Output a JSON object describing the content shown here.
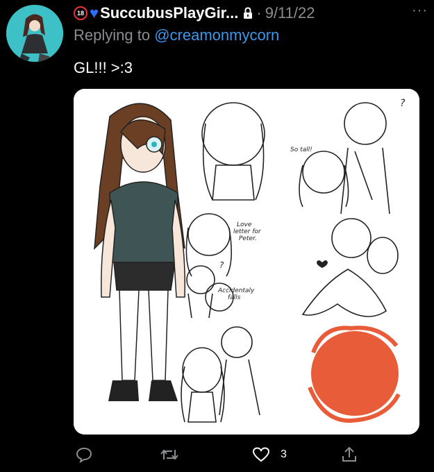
{
  "tweet": {
    "badge": "18",
    "display_name": "SuccubusPlayGir...",
    "date": "9/11/22",
    "separator": "·",
    "more": "···",
    "replying_prefix": "Replying to",
    "replying_handle": "@creamonmycorn",
    "text": "GL!!! >:3"
  },
  "artwork_notes": {
    "so_tall": "So tall!",
    "question1": "?",
    "love_letter": "Love letter for Peter.",
    "question2": "?",
    "accidentally_falls": "Accidentaly falls"
  },
  "actions": {
    "like_count": "3"
  },
  "colors": {
    "link": "#3b98ea",
    "muted": "#8a8d91",
    "heart_emoji": "#2f6df5",
    "scribble": "#e8542f",
    "avatar_bg": "#3ec0c7"
  }
}
